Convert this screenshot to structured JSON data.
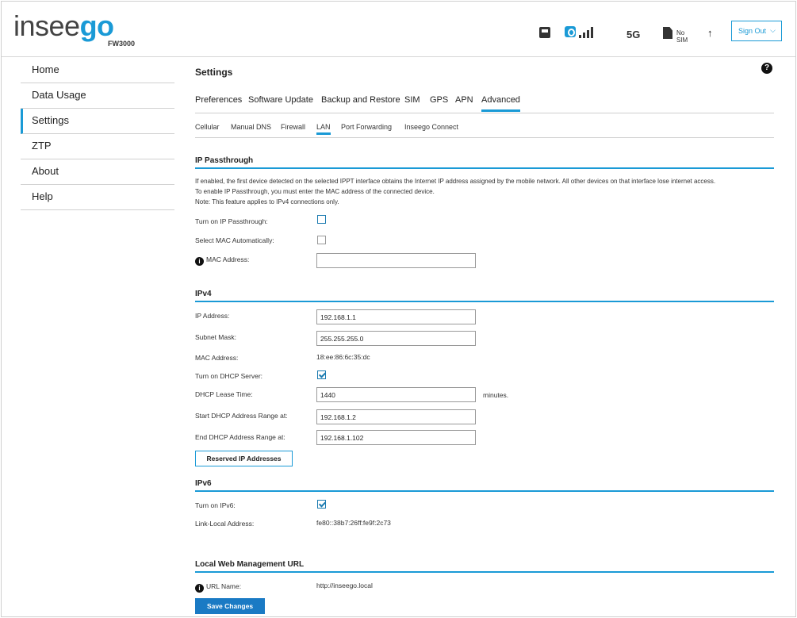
{
  "header": {
    "logo_main": "insee",
    "logo_accent": "go",
    "model": "FW3000",
    "network": "5G",
    "sim_status": "No SIM",
    "upload_arrow": "↑",
    "signout_label": "Sign Out",
    "signout_chevron": "⌵"
  },
  "sidebar": {
    "items": [
      {
        "label": "Home"
      },
      {
        "label": "Data Usage"
      },
      {
        "label": "Settings"
      },
      {
        "label": "ZTP"
      },
      {
        "label": "About"
      },
      {
        "label": "Help"
      }
    ],
    "active_index": 2
  },
  "page": {
    "title": "Settings",
    "help_glyph": "?"
  },
  "tabs": [
    {
      "label": "Preferences"
    },
    {
      "label": "Software Update"
    },
    {
      "label": "Backup and Restore"
    },
    {
      "label": "SIM"
    },
    {
      "label": "GPS"
    },
    {
      "label": "APN"
    },
    {
      "label": "Advanced"
    }
  ],
  "subtabs": [
    {
      "label": "Cellular"
    },
    {
      "label": "Manual DNS"
    },
    {
      "label": "Firewall"
    },
    {
      "label": "LAN"
    },
    {
      "label": "Port Forwarding"
    },
    {
      "label": "Inseego Connect"
    }
  ],
  "ip_passthrough": {
    "title": "IP Passthrough",
    "desc1": "If enabled, the first device detected on the selected IPPT interface obtains the Internet IP address assigned by the mobile network. All other devices on that interface lose internet access.",
    "desc2": "To enable IP Passthrough, you must enter the MAC address of the connected device.",
    "desc3": "Note: This feature applies to IPv4 connections only.",
    "turn_on_label": "Turn on IP Passthrough:",
    "turn_on_checked": false,
    "select_mac_label": "Select MAC Automatically:",
    "select_mac_checked": false,
    "mac_label": "MAC Address:",
    "mac_value": ""
  },
  "ipv4": {
    "title": "IPv4",
    "ip_label": "IP Address:",
    "ip_value": "192.168.1.1",
    "subnet_label": "Subnet Mask:",
    "subnet_value": "255.255.255.0",
    "mac_label": "MAC Address:",
    "mac_value": "18:ee:86:6c:35:dc",
    "dhcp_label": "Turn on DHCP Server:",
    "dhcp_checked": true,
    "lease_label": "DHCP Lease Time:",
    "lease_value": "1440",
    "lease_suffix": "minutes.",
    "start_label": "Start DHCP Address Range at:",
    "start_value": "192.168.1.2",
    "end_label": "End DHCP Address Range at:",
    "end_value": "192.168.1.102",
    "reserved_button": "Reserved IP Addresses"
  },
  "ipv6": {
    "title": "IPv6",
    "turn_on_label": "Turn on IPv6:",
    "turn_on_checked": true,
    "link_local_label": "Link-Local Address:",
    "link_local_value": "fe80::38b7:26ff:fe9f:2c73"
  },
  "web_mgmt": {
    "title": "Local Web Management URL",
    "url_label": "URL Name:",
    "url_value": "http://inseego.local",
    "save_button": "Save Changes"
  },
  "colors": {
    "accent": "#1a9ad6",
    "primary_button": "#1a7ac4"
  }
}
